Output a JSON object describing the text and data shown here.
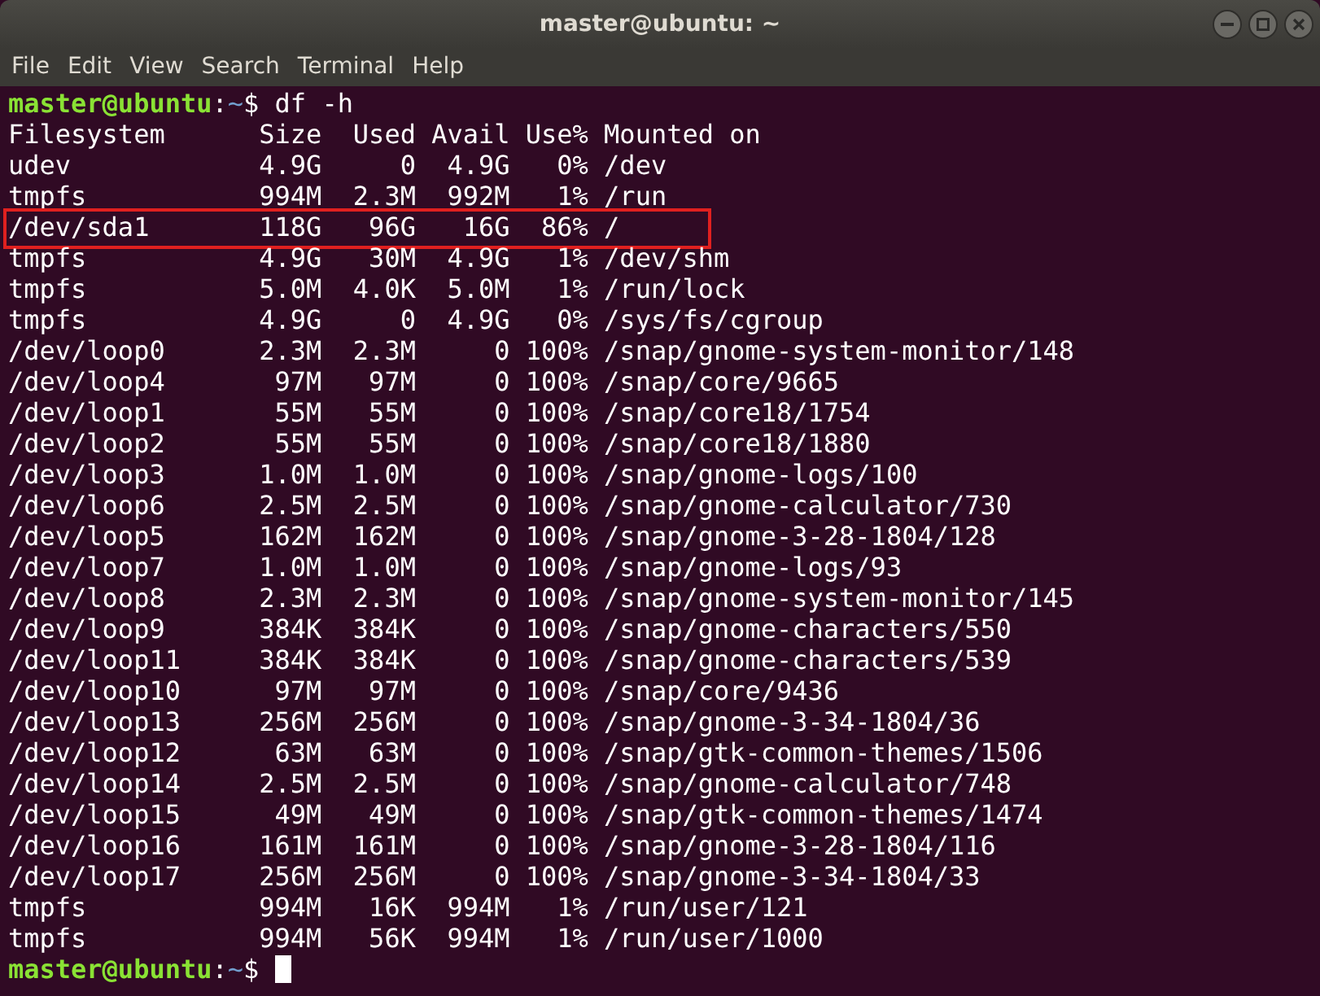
{
  "window": {
    "title": "master@ubuntu: ~"
  },
  "menu": [
    "File",
    "Edit",
    "View",
    "Search",
    "Terminal",
    "Help"
  ],
  "lines": [
    {
      "kind": "prompt",
      "user_host": "master@ubuntu",
      "colon": ":",
      "path": "~",
      "sign": "$",
      "command": " df -h",
      "cursor": false
    },
    {
      "kind": "output",
      "text": "Filesystem      Size  Used Avail Use% Mounted on",
      "highlighted": false
    },
    {
      "kind": "output",
      "text": "udev            4.9G     0  4.9G   0% /dev",
      "highlighted": false
    },
    {
      "kind": "output",
      "text": "tmpfs           994M  2.3M  992M   1% /run",
      "highlighted": false
    },
    {
      "kind": "output",
      "text": "/dev/sda1       118G   96G   16G  86% /",
      "highlighted": true
    },
    {
      "kind": "output",
      "text": "tmpfs           4.9G   30M  4.9G   1% /dev/shm",
      "highlighted": false
    },
    {
      "kind": "output",
      "text": "tmpfs           5.0M  4.0K  5.0M   1% /run/lock",
      "highlighted": false
    },
    {
      "kind": "output",
      "text": "tmpfs           4.9G     0  4.9G   0% /sys/fs/cgroup",
      "highlighted": false
    },
    {
      "kind": "output",
      "text": "/dev/loop0      2.3M  2.3M     0 100% /snap/gnome-system-monitor/148",
      "highlighted": false
    },
    {
      "kind": "output",
      "text": "/dev/loop4       97M   97M     0 100% /snap/core/9665",
      "highlighted": false
    },
    {
      "kind": "output",
      "text": "/dev/loop1       55M   55M     0 100% /snap/core18/1754",
      "highlighted": false
    },
    {
      "kind": "output",
      "text": "/dev/loop2       55M   55M     0 100% /snap/core18/1880",
      "highlighted": false
    },
    {
      "kind": "output",
      "text": "/dev/loop3      1.0M  1.0M     0 100% /snap/gnome-logs/100",
      "highlighted": false
    },
    {
      "kind": "output",
      "text": "/dev/loop6      2.5M  2.5M     0 100% /snap/gnome-calculator/730",
      "highlighted": false
    },
    {
      "kind": "output",
      "text": "/dev/loop5      162M  162M     0 100% /snap/gnome-3-28-1804/128",
      "highlighted": false
    },
    {
      "kind": "output",
      "text": "/dev/loop7      1.0M  1.0M     0 100% /snap/gnome-logs/93",
      "highlighted": false
    },
    {
      "kind": "output",
      "text": "/dev/loop8      2.3M  2.3M     0 100% /snap/gnome-system-monitor/145",
      "highlighted": false
    },
    {
      "kind": "output",
      "text": "/dev/loop9      384K  384K     0 100% /snap/gnome-characters/550",
      "highlighted": false
    },
    {
      "kind": "output",
      "text": "/dev/loop11     384K  384K     0 100% /snap/gnome-characters/539",
      "highlighted": false
    },
    {
      "kind": "output",
      "text": "/dev/loop10      97M   97M     0 100% /snap/core/9436",
      "highlighted": false
    },
    {
      "kind": "output",
      "text": "/dev/loop13     256M  256M     0 100% /snap/gnome-3-34-1804/36",
      "highlighted": false
    },
    {
      "kind": "output",
      "text": "/dev/loop12      63M   63M     0 100% /snap/gtk-common-themes/1506",
      "highlighted": false
    },
    {
      "kind": "output",
      "text": "/dev/loop14     2.5M  2.5M     0 100% /snap/gnome-calculator/748",
      "highlighted": false
    },
    {
      "kind": "output",
      "text": "/dev/loop15      49M   49M     0 100% /snap/gtk-common-themes/1474",
      "highlighted": false
    },
    {
      "kind": "output",
      "text": "/dev/loop16     161M  161M     0 100% /snap/gnome-3-28-1804/116",
      "highlighted": false
    },
    {
      "kind": "output",
      "text": "/dev/loop17     256M  256M     0 100% /snap/gnome-3-34-1804/33",
      "highlighted": false
    },
    {
      "kind": "output",
      "text": "tmpfs           994M   16K  994M   1% /run/user/121",
      "highlighted": false
    },
    {
      "kind": "output",
      "text": "tmpfs           994M   56K  994M   1% /run/user/1000",
      "highlighted": false
    },
    {
      "kind": "prompt",
      "user_host": "master@ubuntu",
      "colon": ":",
      "path": "~",
      "sign": "$",
      "cursor": true
    }
  ]
}
